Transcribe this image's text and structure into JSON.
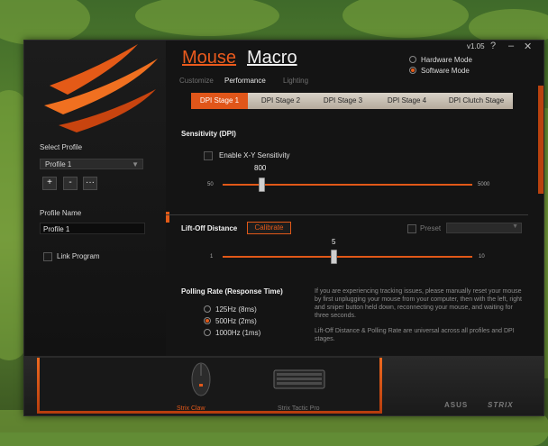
{
  "header": {
    "tabs": [
      {
        "label": "Mouse",
        "active": true
      },
      {
        "label": "Macro",
        "active": false
      }
    ],
    "subnav": [
      {
        "label": "Customize",
        "active": false
      },
      {
        "label": "Performance",
        "active": true
      },
      {
        "label": "Lighting",
        "active": false
      }
    ],
    "version": "v1.05",
    "help_icon": "?",
    "minimize_icon": "–",
    "close_icon": "✕",
    "modes": [
      {
        "label": "Hardware Mode",
        "selected": false
      },
      {
        "label": "Software Mode",
        "selected": true
      }
    ]
  },
  "left_panel": {
    "select_profile_label": "Select Profile",
    "profile_selected": "Profile 1",
    "add_label": "+",
    "remove_label": "-",
    "more_label": "···",
    "profile_name_label": "Profile Name",
    "profile_name_value": "Profile 1",
    "link_program_label": "Link Program"
  },
  "dpi_tabs": [
    {
      "label": "DPI Stage 1",
      "active": true
    },
    {
      "label": "DPI Stage 2",
      "active": false
    },
    {
      "label": "DPI Stage 3",
      "active": false
    },
    {
      "label": "DPI Stage 4",
      "active": false
    },
    {
      "label": "DPI Clutch Stage",
      "active": false
    }
  ],
  "sensitivity": {
    "title": "Sensitivity (DPI)",
    "xy_label": "Enable X-Y Sensitivity",
    "value": "800",
    "min_label": "50",
    "max_label": "5000",
    "position": 0.154
  },
  "liftoff": {
    "title": "Lift-Off Distance",
    "calibrate_label": "Calibrate",
    "preset_label": "Preset",
    "value": "5",
    "min_label": "1",
    "max_label": "10",
    "position": 0.444
  },
  "polling": {
    "title": "Polling Rate (Response Time)",
    "options": [
      {
        "label": "125Hz (8ms)",
        "selected": false
      },
      {
        "label": "500Hz (2ms)",
        "selected": true
      },
      {
        "label": "1000Hz (1ms)",
        "selected": false
      }
    ],
    "info1": "If you are experiencing tracking issues, please manually reset your mouse by first unplugging your mouse from your computer, then with the left, right and sniper button held down, reconnecting your mouse, and waiting for three seconds.",
    "info2": "Lift-Off Distance & Polling Rate are universal across all profiles and DPI stages."
  },
  "devices": [
    {
      "label": "Strix Claw",
      "selected": true
    },
    {
      "label": "Strix Tactic Pro",
      "selected": false
    }
  ],
  "brands": {
    "asus": "ASUS",
    "strix": "STRIX"
  },
  "colors": {
    "accent": "#e2581a",
    "panel": "#141414",
    "tabs": "#c9bfb2"
  }
}
